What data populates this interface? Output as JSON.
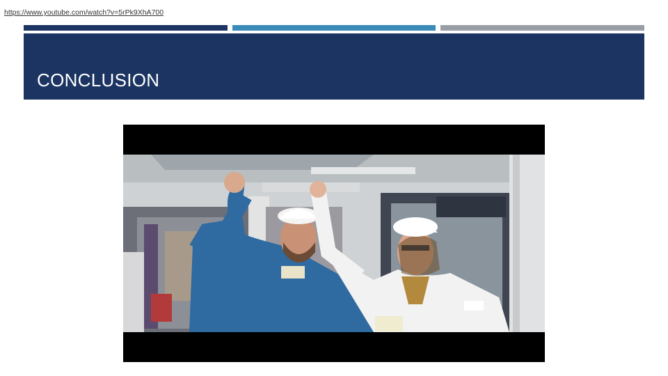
{
  "source": {
    "url_text": "https://www.youtube.com/watch?v=5rPk9XhA700"
  },
  "slide": {
    "title": "CONCLUSION"
  },
  "colors": {
    "title_band": "#1b3461",
    "accent_dark_blue": "#1c3461",
    "accent_light_blue": "#3b8bb8",
    "accent_gray": "#999ea6"
  },
  "video": {
    "description_icon": "embedded-video-frame"
  }
}
